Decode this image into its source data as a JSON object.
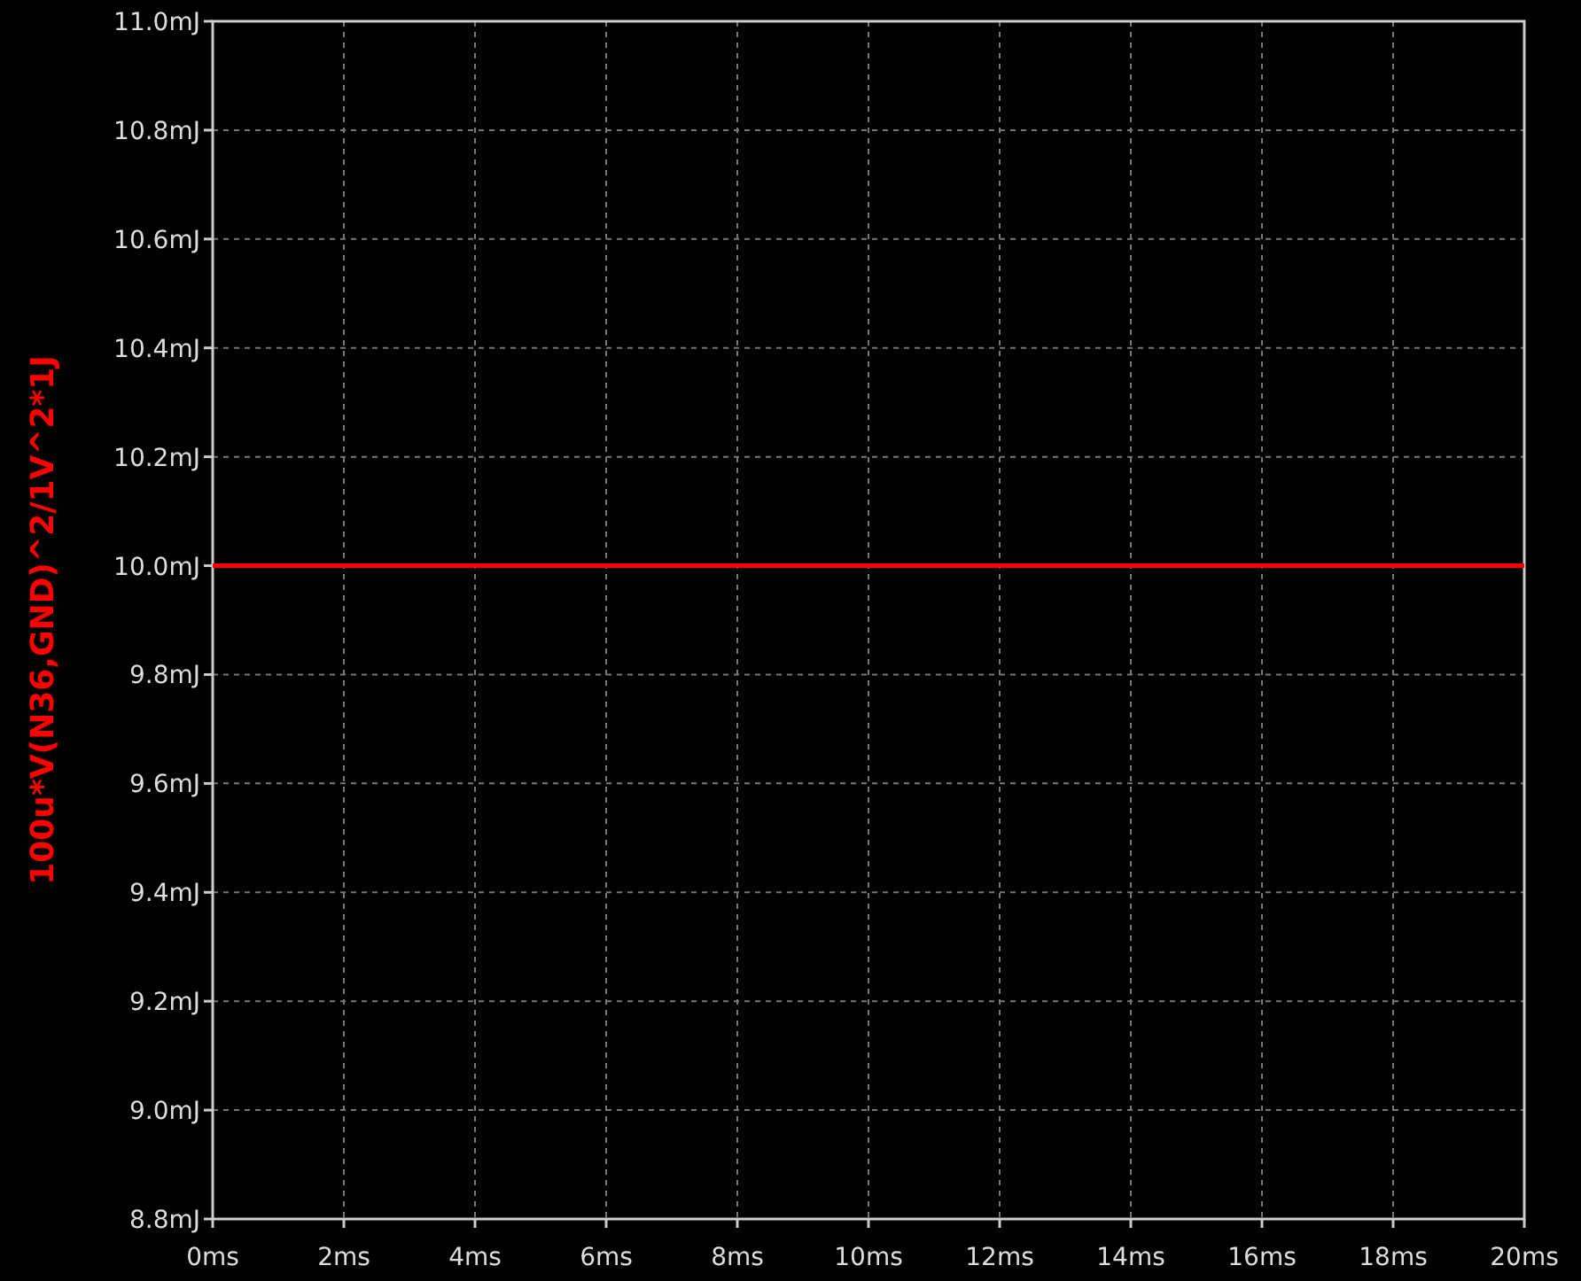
{
  "plot": {
    "chart_data": {
      "type": "line",
      "ylabel": "100u*V(N36,GND)^2/1V^2*1J",
      "x": [
        0,
        20
      ],
      "series": [
        {
          "color": "#ff0000",
          "values": [
            10.0,
            10.0
          ]
        }
      ],
      "grid": true,
      "xlim": [
        0,
        20
      ],
      "ylim": [
        8.8,
        11.0
      ],
      "xticks": [
        {
          "value": 0,
          "label": "0ms"
        },
        {
          "value": 2,
          "label": "2ms"
        },
        {
          "value": 4,
          "label": "4ms"
        },
        {
          "value": 6,
          "label": "6ms"
        },
        {
          "value": 8,
          "label": "8ms"
        },
        {
          "value": 10,
          "label": "10ms"
        },
        {
          "value": 12,
          "label": "12ms"
        },
        {
          "value": 14,
          "label": "14ms"
        },
        {
          "value": 16,
          "label": "16ms"
        },
        {
          "value": 18,
          "label": "18ms"
        },
        {
          "value": 20,
          "label": "20ms"
        }
      ],
      "yticks": [
        {
          "value": 8.8,
          "label": "8.8mJ"
        },
        {
          "value": 9.0,
          "label": "9.0mJ"
        },
        {
          "value": 9.2,
          "label": "9.2mJ"
        },
        {
          "value": 9.4,
          "label": "9.4mJ"
        },
        {
          "value": 9.6,
          "label": "9.6mJ"
        },
        {
          "value": 9.8,
          "label": "9.8mJ"
        },
        {
          "value": 10.0,
          "label": "10.0mJ"
        },
        {
          "value": 10.2,
          "label": "10.2mJ"
        },
        {
          "value": 10.4,
          "label": "10.4mJ"
        },
        {
          "value": 10.6,
          "label": "10.6mJ"
        },
        {
          "value": 10.8,
          "label": "10.8mJ"
        },
        {
          "value": 11.0,
          "label": "11.0mJ"
        }
      ]
    }
  }
}
